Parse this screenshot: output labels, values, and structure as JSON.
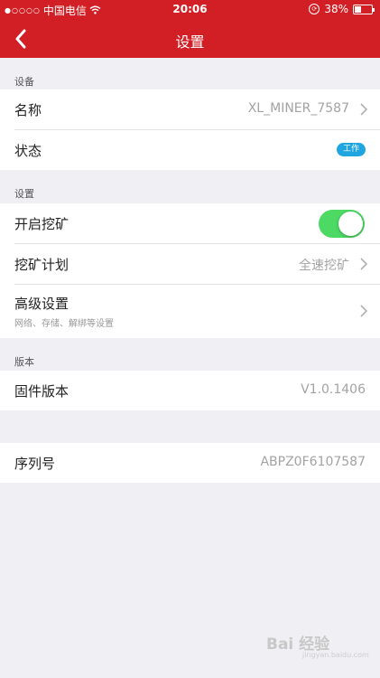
{
  "status_bar": {
    "signal": "●○○○○",
    "carrier": "中国电信",
    "time": "20:06",
    "battery_percent": "38%",
    "battery_level": 0.38
  },
  "nav": {
    "title": "设置",
    "back_icon": "chevron-left-icon"
  },
  "sections": {
    "device": {
      "header": "设备",
      "name_label": "名称",
      "name_value": "XL_MINER_7587",
      "status_label": "状态",
      "status_badge": "工作"
    },
    "settings": {
      "header": "设置",
      "mining_toggle_label": "开启挖矿",
      "mining_toggle_on": true,
      "plan_label": "挖矿计划",
      "plan_value": "全速挖矿",
      "advanced_label": "高级设置",
      "advanced_sub": "网络、存储、解绑等设置"
    },
    "version": {
      "header": "版本",
      "firmware_label": "固件版本",
      "firmware_value": "V1.0.1406"
    },
    "serial": {
      "label": "序列号",
      "value": "ABPZ0F6107587"
    }
  },
  "watermark": {
    "text": "Bai 经验",
    "sub": "jingyan.baidu.com"
  },
  "colors": {
    "brand_red": "#d21f25",
    "toggle_green": "#4cd964",
    "badge_blue": "#1fa5e0",
    "background": "#efeff4"
  }
}
